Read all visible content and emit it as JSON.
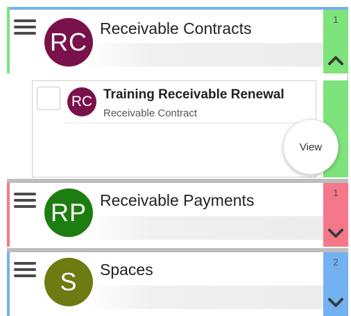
{
  "colors": {
    "green": "#7ee37a",
    "pink": "#f4788a",
    "blue": "#72b2f0",
    "rc_avatar": "#79124a",
    "rp_avatar": "#1e7d10",
    "spaces_avatar": "#6e7a12"
  },
  "sections": [
    {
      "initials": "RC",
      "title": "Receivable Contracts",
      "count": "1",
      "toggle_icon": "chevron-up-icon"
    },
    {
      "initials": "RP",
      "title": "Receivable Payments",
      "count": "1",
      "toggle_icon": "chevron-down-icon"
    },
    {
      "initials": "S",
      "title": "Spaces",
      "count": "2",
      "toggle_icon": "chevron-down-icon"
    }
  ],
  "card": {
    "initials": "RC",
    "title": "Training Receivable Renewal",
    "subtitle": "Receivable Contract",
    "view_label": "View"
  }
}
